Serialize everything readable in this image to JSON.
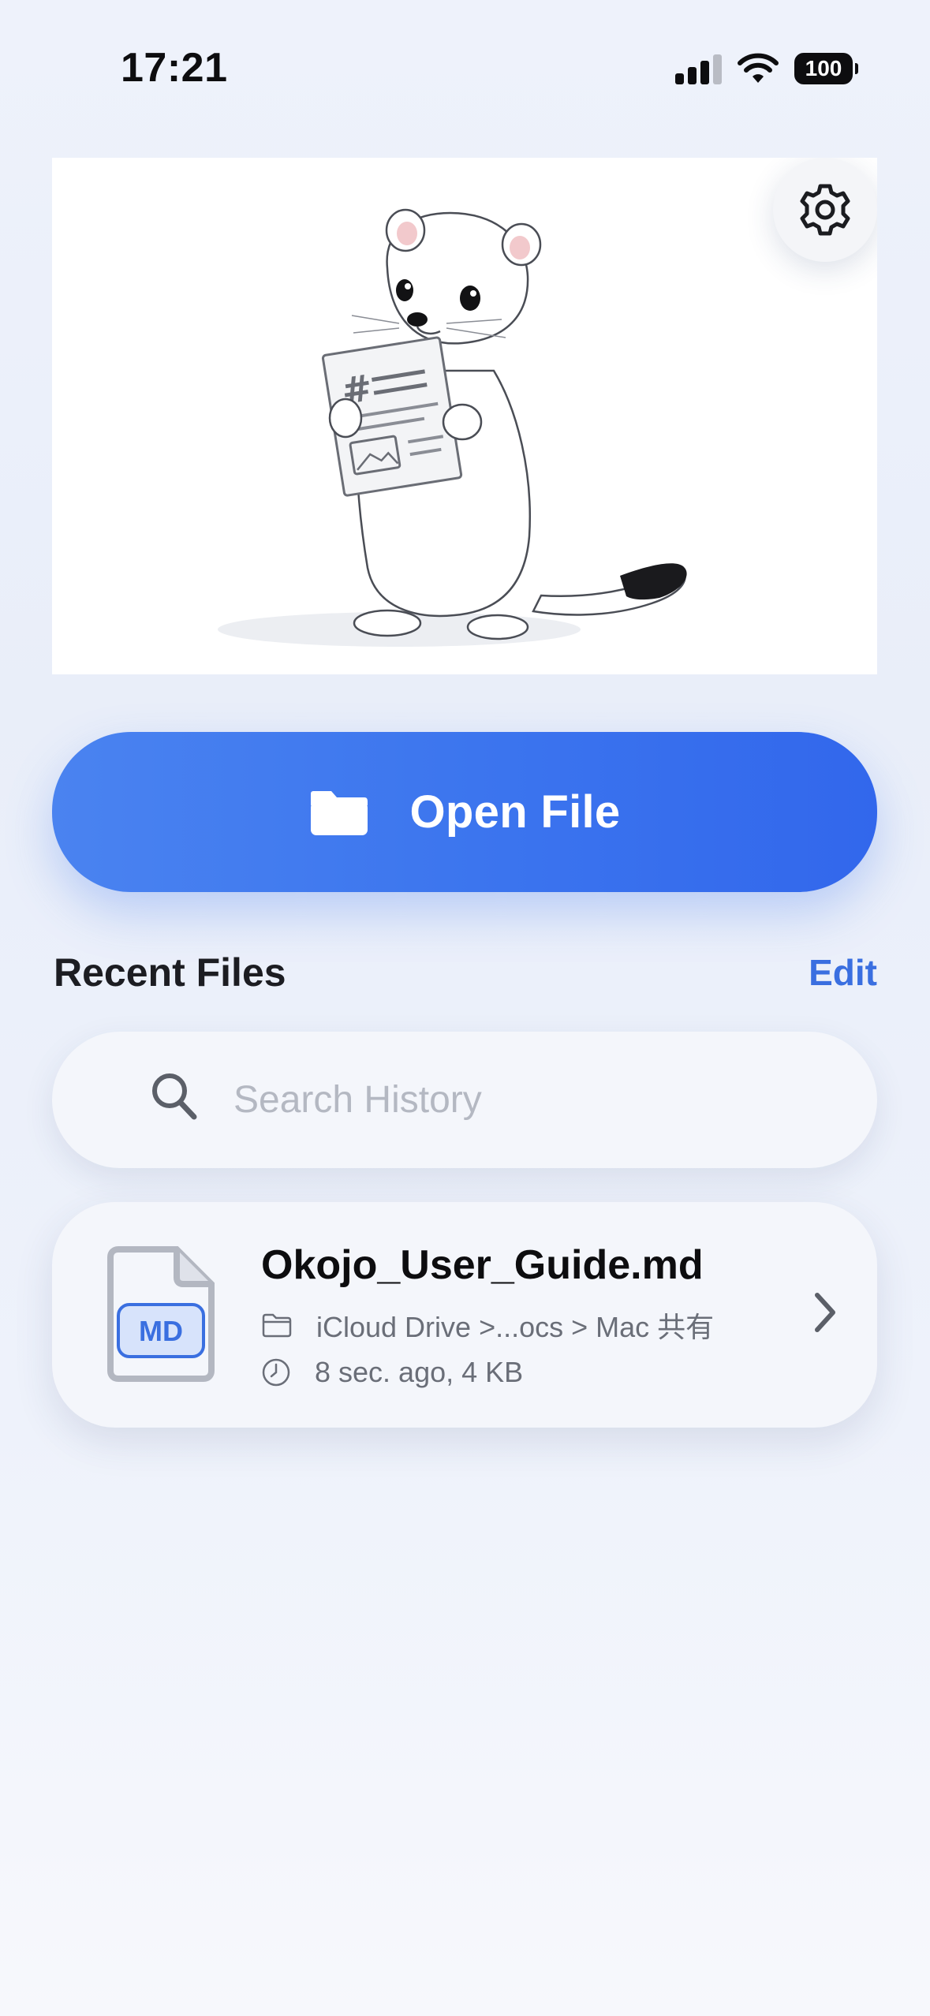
{
  "status": {
    "time": "17:21",
    "battery": "100"
  },
  "icons": {
    "settings": "gear-icon",
    "open": "folder-icon",
    "search": "search-icon",
    "file": "md-file-icon",
    "location": "folder-outline-icon",
    "time": "clock-icon",
    "disclosure": "chevron-right-icon"
  },
  "colors": {
    "accent": "#3b74ee",
    "edit": "#3a6fe0"
  },
  "open_button": {
    "label": "Open File"
  },
  "recent": {
    "title": "Recent Files",
    "edit_label": "Edit",
    "search": {
      "placeholder": "Search History",
      "value": ""
    },
    "files": [
      {
        "badge": "MD",
        "name": "Okojo_User_Guide.md",
        "location": "iCloud Drive >...ocs > Mac 共有",
        "meta": "8 sec. ago, 4 KB"
      }
    ]
  }
}
